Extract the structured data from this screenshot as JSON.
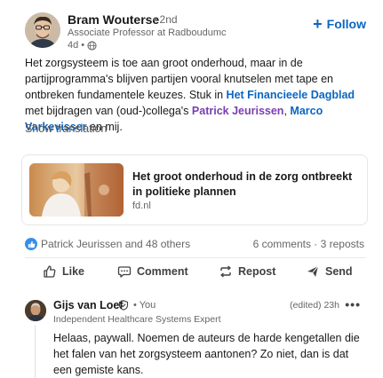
{
  "post": {
    "author": {
      "name": "Bram Wouterse",
      "degree": "• 2nd",
      "title": "Associate Professor at Radboudumc",
      "time": "4d •"
    },
    "follow_label": "Follow",
    "body": {
      "text_1": "Het zorgsysteem is toe aan groot onderhoud, maar in de partijprogramma's blijven partijen vooral knutselen met tape en ontbreken fundamentele keuzes. Stuk in ",
      "link_paper": "Het Financieele Dagblad",
      "text_2": " met bijdragen van (oud-)collega's ",
      "mention_1": "Patrick Jeurissen",
      "sep": ", ",
      "mention_2": "Marco Varkevisser",
      "text_3": " en mij."
    },
    "show_translation": "Show translation",
    "article": {
      "title": "Het groot onderhoud in de zorg ontbreekt in politieke plannen",
      "source": "fd.nl"
    },
    "social": {
      "reactions_text": "Patrick Jeurissen and 48 others",
      "counts_text": "6 comments · 3 reposts"
    },
    "actions": {
      "like": "Like",
      "comment": "Comment",
      "repost": "Repost",
      "send": "Send"
    }
  },
  "comment": {
    "name": "Gijs van Loef",
    "you_label": "• You",
    "title": "Independent Healthcare Systems Expert",
    "time": "(edited) 23h",
    "more": "•••",
    "text": "Helaas, paywall. Noemen de auteurs de harde kengetallen die het falen van het zorgsysteem aantonen? Zo niet, dan is dat een gemiste kans."
  },
  "icons": {
    "globe": "globe-icon",
    "plus": "plus-icon",
    "like_reaction": "like-reaction-icon",
    "like": "thumbs-up-icon",
    "comment": "comment-bubble-icon",
    "repost": "repost-arrows-icon",
    "send": "send-paper-plane-icon",
    "verified": "verified-shield-icon",
    "more": "more-dots-icon"
  },
  "colors": {
    "accent": "#0a66c2",
    "mention": "#7a3eb1",
    "reaction": "#378fe9"
  }
}
